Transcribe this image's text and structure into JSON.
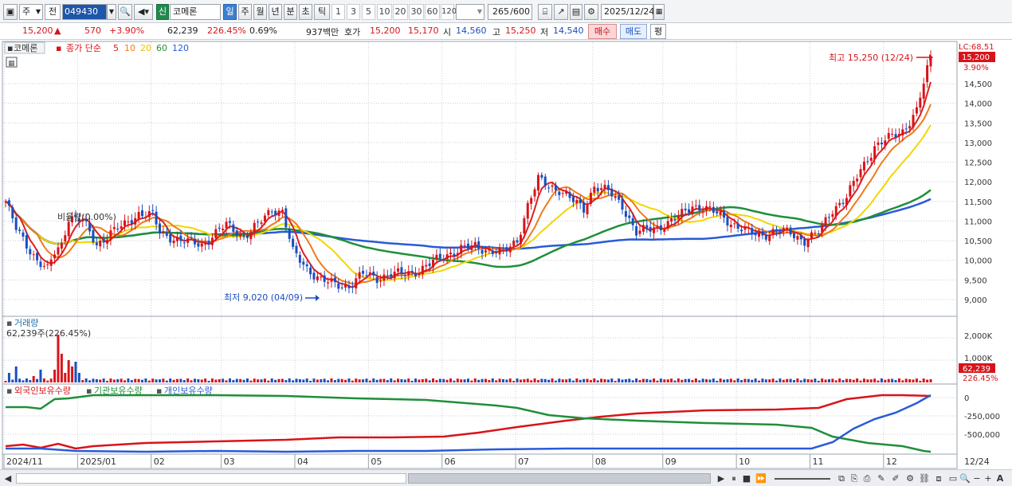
{
  "toolbar": {
    "period_type": "주",
    "market_type": "전",
    "code": "049430",
    "market_badge": "신",
    "name": "코메론",
    "intervals": [
      "일",
      "주",
      "월",
      "년",
      "분",
      "초",
      "틱"
    ],
    "minute_buttons": [
      "1",
      "3",
      "5",
      "10",
      "20",
      "30",
      "60",
      "120"
    ],
    "count_display": "265",
    "count_total": "/600",
    "date": "2025/12/24"
  },
  "quote": {
    "price": "15,200",
    "change": "570",
    "change_pct": "+3.90%",
    "volume": "62,239",
    "volume_ratio": "226.45%",
    "turnover": "0.69%",
    "amount": "937백만",
    "ask_label": "호가",
    "ask": "15,200",
    "bid": "15,170",
    "open_label": "시",
    "open": "14,560",
    "high_label": "고",
    "high": "15,250",
    "low_label": "저",
    "low": "14,540",
    "buy_label": "매수",
    "sell_label": "매도",
    "avg_label": "평"
  },
  "legend": {
    "name": "코메론",
    "ma_prefix": "종가 단순",
    "ma": [
      {
        "label": "5",
        "color": "#e01e1e"
      },
      {
        "label": "10",
        "color": "#f07a1a"
      },
      {
        "label": "20",
        "color": "#f2d600"
      },
      {
        "label": "60",
        "color": "#1f8f3a"
      },
      {
        "label": "120",
        "color": "#2a5ad8"
      }
    ]
  },
  "price_panel": {
    "lc_label": "LC:68,51",
    "current_price": "15,200",
    "current_pct": "3.90%",
    "high_annotation": "최고 15,250 (12/24)",
    "low_annotation": "최저 9,020 (04/09)",
    "mid_label": "비율량(0.00%)",
    "y_labels": [
      "14,500",
      "14,000",
      "13,500",
      "13,000",
      "12,500",
      "12,000",
      "11,500",
      "11,000",
      "10,500",
      "10,000",
      "9,500",
      "9,000"
    ]
  },
  "volume_panel": {
    "title": "거래량",
    "value": "62,239주(226.45%)",
    "y_labels": [
      "2,000K",
      "1,000K"
    ],
    "current": "62,239",
    "current_pct": "226.45%"
  },
  "holding_panel": {
    "legend": [
      {
        "label": "외국인보유수량",
        "color": "#d8141a"
      },
      {
        "label": "기관보유수량",
        "color": "#1f8f3a"
      },
      {
        "label": "개인보유수량",
        "color": "#2a5ad8"
      }
    ],
    "y_labels": [
      "0",
      "-250,000",
      "-500,000"
    ]
  },
  "x_axis": {
    "labels": [
      "2024/11",
      "2025/01",
      "02",
      "03",
      "04",
      "05",
      "06",
      "07",
      "08",
      "09",
      "10",
      "11",
      "12"
    ],
    "right_label": "12/24"
  },
  "colors": {
    "up": "#d8141a",
    "down": "#1a4fc0",
    "ma5": "#e01e1e",
    "ma10": "#f07a1a",
    "ma20": "#f2d600",
    "ma60": "#1f8f3a",
    "ma120": "#2a5ad8"
  },
  "bottom": {
    "right_letter": "A"
  }
}
